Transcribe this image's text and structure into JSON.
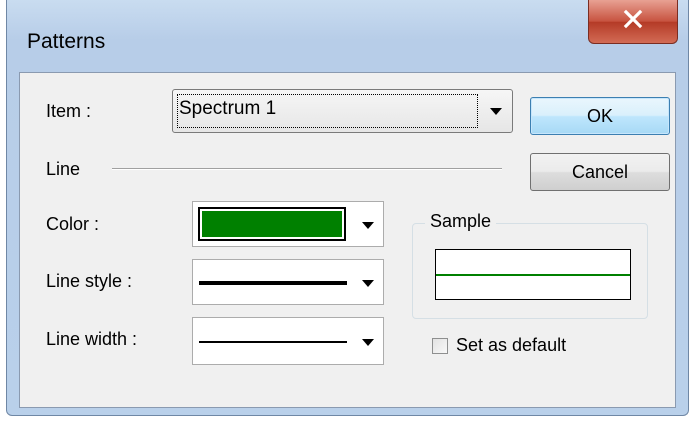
{
  "dialog": {
    "title": "Patterns"
  },
  "fields": {
    "item_label": "Item :",
    "item_value": "Spectrum 1",
    "line_group_label": "Line",
    "color_label": "Color :",
    "color_value": "#008000",
    "line_style_label": "Line style :",
    "line_width_label": "Line width :"
  },
  "buttons": {
    "ok": "OK",
    "cancel": "Cancel"
  },
  "sample": {
    "legend": "Sample",
    "line_color": "#008000"
  },
  "set_as_default": {
    "label": "Set as default",
    "checked": false
  },
  "icons": {
    "close": "close-icon",
    "dropdown": "chevron-down-icon"
  }
}
